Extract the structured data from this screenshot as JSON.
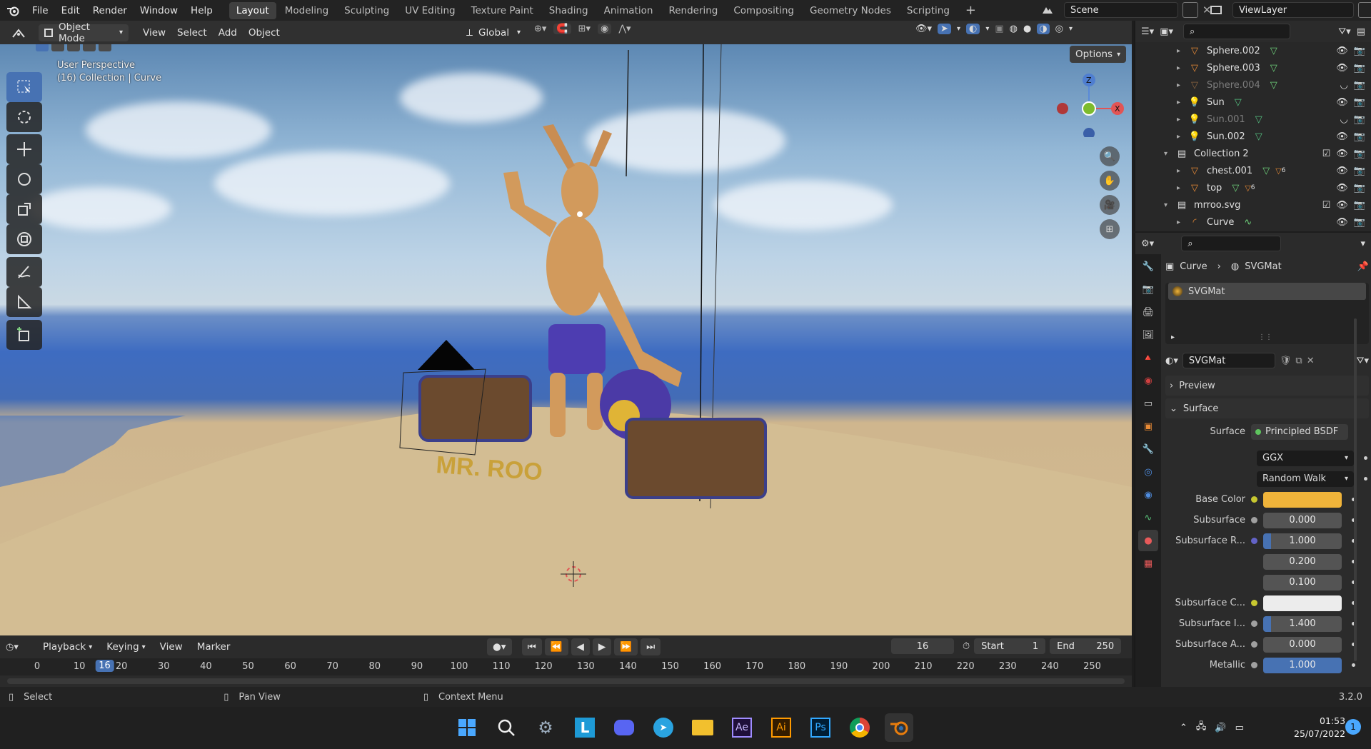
{
  "topbar": {
    "menus": [
      "File",
      "Edit",
      "Render",
      "Window",
      "Help"
    ],
    "workspaces": [
      "Layout",
      "Modeling",
      "Sculpting",
      "UV Editing",
      "Texture Paint",
      "Shading",
      "Animation",
      "Rendering",
      "Compositing",
      "Geometry Nodes",
      "Scripting"
    ],
    "add_workspace": "+",
    "scene": "Scene",
    "view_layer": "ViewLayer"
  },
  "viewport_header": {
    "mode": "Object Mode",
    "menus": [
      "View",
      "Select",
      "Add",
      "Object"
    ],
    "transform": "Global",
    "options": "Options"
  },
  "viewport": {
    "perspective": "User Perspective",
    "collection": "(16) Collection | Curve",
    "gizmo_axes": {
      "z": "Z",
      "x": "X"
    },
    "sign_text": "MR. ROO"
  },
  "outliner": {
    "rows": [
      {
        "name": "Sphere.002",
        "dim": false
      },
      {
        "name": "Sphere.003",
        "dim": false
      },
      {
        "name": "Sphere.004",
        "dim": true
      },
      {
        "name": "Sun",
        "dim": false
      },
      {
        "name": "Sun.001",
        "dim": true
      },
      {
        "name": "Sun.002",
        "dim": false
      },
      {
        "name": "Collection 2",
        "dim": false
      },
      {
        "name": "chest.001",
        "dim": false,
        "badge": "6"
      },
      {
        "name": "top",
        "dim": false,
        "badge": "6"
      },
      {
        "name": "mrroo.svg",
        "dim": false
      },
      {
        "name": "Curve",
        "dim": false
      }
    ]
  },
  "properties": {
    "breadcrumb_object": "Curve",
    "breadcrumb_material": "SVGMat",
    "slot_name": "SVGMat",
    "material_name": "SVGMat",
    "panel_preview": "Preview",
    "panel_surface": "Surface",
    "surface_label": "Surface",
    "surface_value": "Principled BSDF",
    "distribution": "GGX",
    "subsurface_method": "Random Walk",
    "fields": [
      {
        "label": "Base Color",
        "value": "",
        "socket": "#c8c830",
        "kind": "color",
        "color": "#f0b43a"
      },
      {
        "label": "Subsurface",
        "value": "0.000",
        "socket": "#a0a0a0",
        "kind": "num"
      },
      {
        "label": "Subsurface R...",
        "value": "1.000",
        "socket": "#6363c7",
        "kind": "num"
      },
      {
        "label": "",
        "value": "0.200",
        "socket": "",
        "kind": "num"
      },
      {
        "label": "",
        "value": "0.100",
        "socket": "",
        "kind": "num"
      },
      {
        "label": "Subsurface C...",
        "value": "",
        "socket": "#c8c830",
        "kind": "color",
        "color": "#ececec"
      },
      {
        "label": "Subsurface I...",
        "value": "1.400",
        "socket": "#a0a0a0",
        "kind": "num"
      },
      {
        "label": "Subsurface A...",
        "value": "0.000",
        "socket": "#a0a0a0",
        "kind": "num"
      },
      {
        "label": "Metallic",
        "value": "1.000",
        "socket": "#a0a0a0",
        "kind": "num",
        "fill": 1.0
      }
    ]
  },
  "timeline": {
    "menus": [
      "Playback",
      "Keying",
      "View",
      "Marker"
    ],
    "current_frame": "16",
    "start_label": "Start",
    "start_value": "1",
    "end_label": "End",
    "end_value": "250",
    "ticks": [
      "0",
      "10",
      "20",
      "30",
      "40",
      "50",
      "60",
      "70",
      "80",
      "90",
      "100",
      "110",
      "120",
      "130",
      "140",
      "150",
      "160",
      "170",
      "180",
      "190",
      "200",
      "210",
      "220",
      "230",
      "240",
      "250"
    ],
    "playhead": "16"
  },
  "status": {
    "select": "Select",
    "pan": "Pan View",
    "context": "Context Menu",
    "version": "3.2.0"
  },
  "taskbar": {
    "apps": [
      "Start",
      "Search",
      "Settings",
      "L",
      "Discord",
      "Telegram",
      "File Explorer",
      "Ae",
      "Ai",
      "Ps",
      "Chrome",
      "Blender"
    ],
    "time": "01:53",
    "date": "25/07/2022",
    "notification_count": "1"
  },
  "colors": {
    "accent": "#4772b3",
    "base_color": "#f0b43a",
    "blender_orange": "#e87d0d"
  }
}
